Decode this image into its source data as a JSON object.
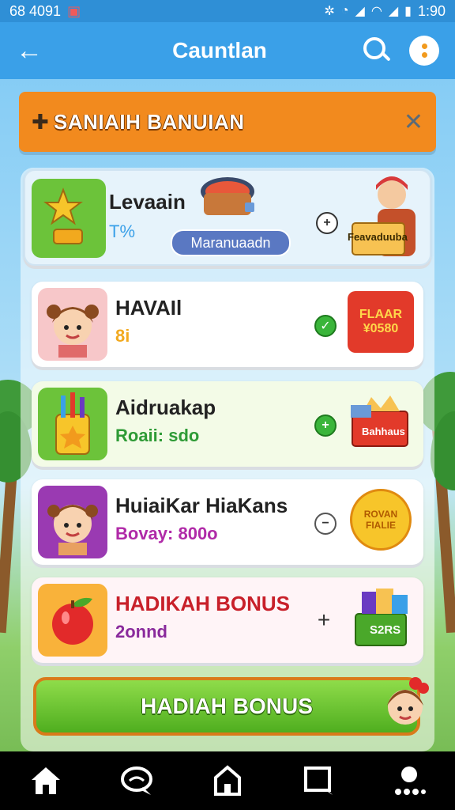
{
  "status_bar": {
    "left_text": "68 4091",
    "time": "1:90"
  },
  "app_bar": {
    "title": "Cauntlan",
    "back_icon": "arrow-left-icon",
    "search_icon": "search-icon",
    "more_icon": "more-dots-icon"
  },
  "banner": {
    "label": "SANIAIH BANUIAN",
    "close_icon": "close-icon"
  },
  "items": [
    {
      "title": "Levaain",
      "subtitle": "T%",
      "badge": "Maranuaadn",
      "action": "+",
      "reward_label": "Feavaduuba"
    },
    {
      "title": "HAVAIl",
      "subtitle": "8i",
      "action": "✓",
      "reward_label": "FLAAR ¥0580"
    },
    {
      "title": "Aidruakap",
      "subtitle": "Roaii: sdo",
      "action": "+",
      "reward_label": "Bahhaus"
    },
    {
      "title": "HuiaiKar HiaKans",
      "subtitle": "Bovay: 800o",
      "action": "−",
      "reward_label": "ROVAN FIALIE"
    },
    {
      "title": "HADIKAH BONUS",
      "subtitle": "2onnd",
      "action": "+",
      "reward_label": "S2RS"
    }
  ],
  "cta": {
    "label": "HADIAH BONUS"
  },
  "nav": [
    "home-icon",
    "chat-icon",
    "house-icon",
    "square-chat-icon",
    "profile-icon"
  ],
  "colors": {
    "app_bar": "#3aa0e8",
    "banner": "#f28a1e",
    "cta": "#4fae1f",
    "accent_green": "#2e9b36",
    "accent_purple": "#8a2a9c"
  }
}
